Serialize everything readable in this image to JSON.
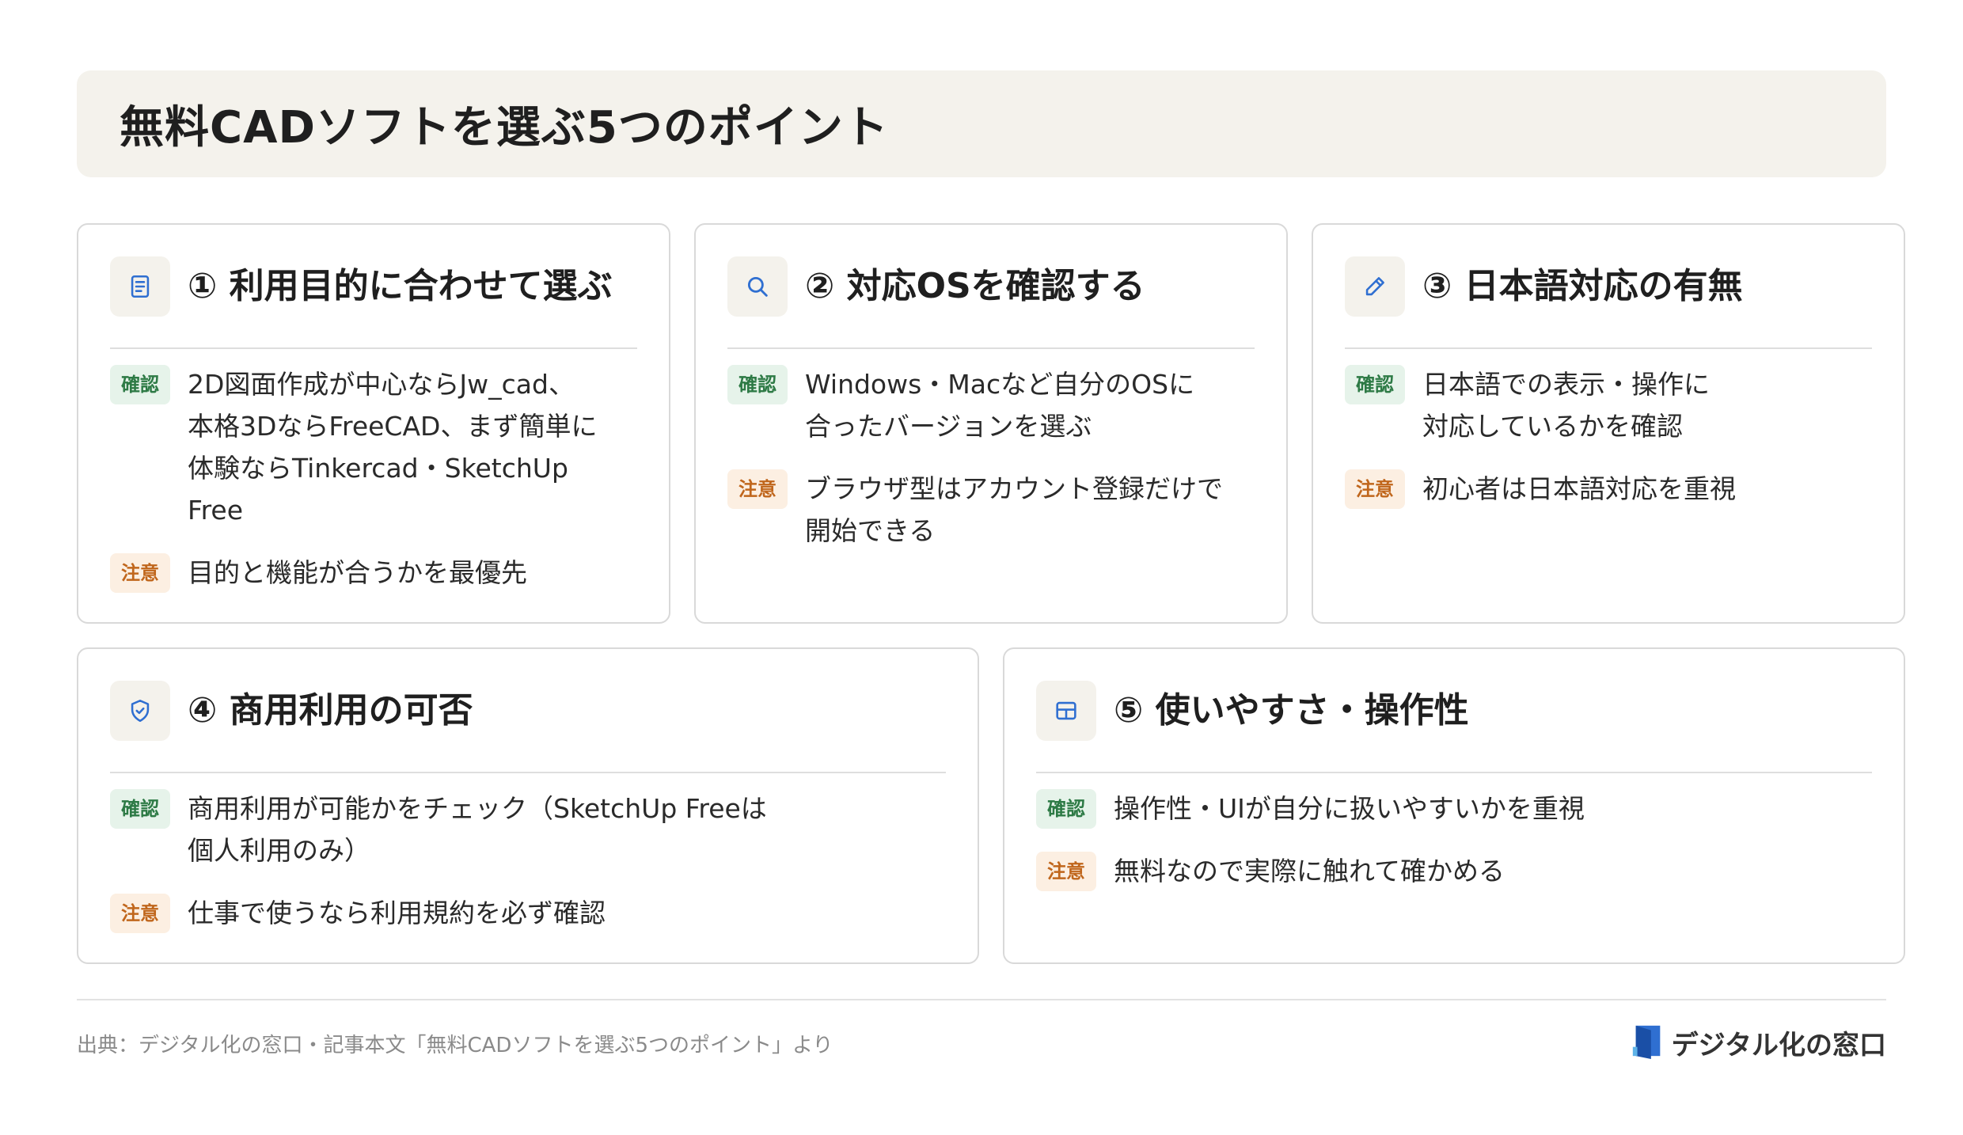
{
  "title": "無料CADソフトを選ぶ5つのポイント",
  "tags": {
    "confirm": "確認",
    "caution": "注意"
  },
  "colors": {
    "confirm_bg": "#e6f3ea",
    "confirm_fg": "#2d7a45",
    "caution_bg": "#fcefe2",
    "caution_fg": "#c0661c",
    "accent_blue": "#2f6fd1"
  },
  "cards": [
    {
      "icon": "document-icon",
      "title": "① 利用目的に合わせて選ぶ",
      "confirm_lines": [
        "2D図面作成が中心ならJw_cad、",
        "本格3DならFreeCAD、まず簡単に",
        "体験ならTinkercad・SketchUp",
        "Free"
      ],
      "caution_lines": [
        "目的と機能が合うかを最優先"
      ]
    },
    {
      "icon": "search-icon",
      "title": "② 対応OSを確認する",
      "confirm_lines": [
        "Windows・Macなど自分のOSに",
        "合ったバージョンを選ぶ"
      ],
      "caution_lines": [
        "ブラウザ型はアカウント登録だけで",
        "開始できる"
      ]
    },
    {
      "icon": "pencil-icon",
      "title": "③ 日本語対応の有無",
      "confirm_lines": [
        "日本語での表示・操作に",
        "対応しているかを確認"
      ],
      "caution_lines": [
        "初心者は日本語対応を重視"
      ]
    },
    {
      "icon": "shield-check-icon",
      "title": "④ 商用利用の可否",
      "confirm_lines": [
        "商用利用が可能かをチェック（SketchUp Freeは",
        "個人利用のみ）"
      ],
      "caution_lines": [
        "仕事で使うなら利用規約を必ず確認"
      ]
    },
    {
      "icon": "layout-grid-icon",
      "title": "⑤ 使いやすさ・操作性",
      "confirm_lines": [
        "操作性・UIが自分に扱いやすいかを重視"
      ],
      "caution_lines": [
        "無料なので実際に触れて確かめる"
      ]
    }
  ],
  "footer": {
    "source": "出典：デジタル化の窓口・記事本文「無料CADソフトを選ぶ5つのポイント」より",
    "brand": "デジタル化の窓口",
    "brand_icon": "door-logo-icon"
  }
}
